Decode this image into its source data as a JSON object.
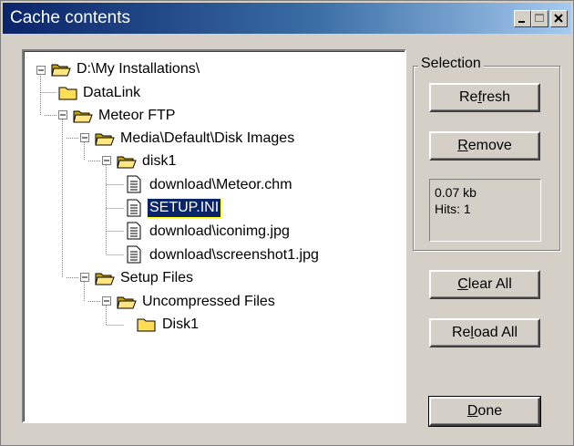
{
  "window": {
    "title": "Cache contents"
  },
  "tree": {
    "nodes": [
      {
        "label": "D:\\My Installations\\",
        "type": "folder-open",
        "expanded": true
      },
      {
        "label": "DataLink",
        "type": "folder"
      },
      {
        "label": "Meteor FTP",
        "type": "folder-open",
        "expanded": true
      },
      {
        "label": "Media\\Default\\Disk Images",
        "type": "folder-open",
        "expanded": true
      },
      {
        "label": "disk1",
        "type": "folder-open",
        "expanded": true
      },
      {
        "label": "download\\Meteor.chm",
        "type": "file"
      },
      {
        "label": "SETUP.INI",
        "type": "file",
        "selected": true
      },
      {
        "label": "download\\iconimg.jpg",
        "type": "file"
      },
      {
        "label": "download\\screenshot1.jpg",
        "type": "file"
      },
      {
        "label": "Setup Files",
        "type": "folder-open",
        "expanded": true
      },
      {
        "label": "Uncompressed Files",
        "type": "folder-open",
        "expanded": true
      },
      {
        "label": "Disk1",
        "type": "folder"
      }
    ]
  },
  "selection": {
    "legend": "Selection",
    "refresh": {
      "pre": "Re",
      "key": "f",
      "post": "resh"
    },
    "remove": {
      "pre": "",
      "key": "R",
      "post": "emove"
    },
    "size": "0.07 kb",
    "hits": "Hits: 1"
  },
  "buttons": {
    "clear_all": {
      "pre": "",
      "key": "C",
      "post": "lear All"
    },
    "reload_all": {
      "pre": "Re",
      "key": "l",
      "post": "oad All"
    },
    "done": {
      "pre": "",
      "key": "D",
      "post": "one"
    }
  },
  "colors": {
    "title_start": "#0a246a",
    "title_end": "#a6caf0",
    "face": "#d4d0c8",
    "selection": "#0a246a"
  }
}
